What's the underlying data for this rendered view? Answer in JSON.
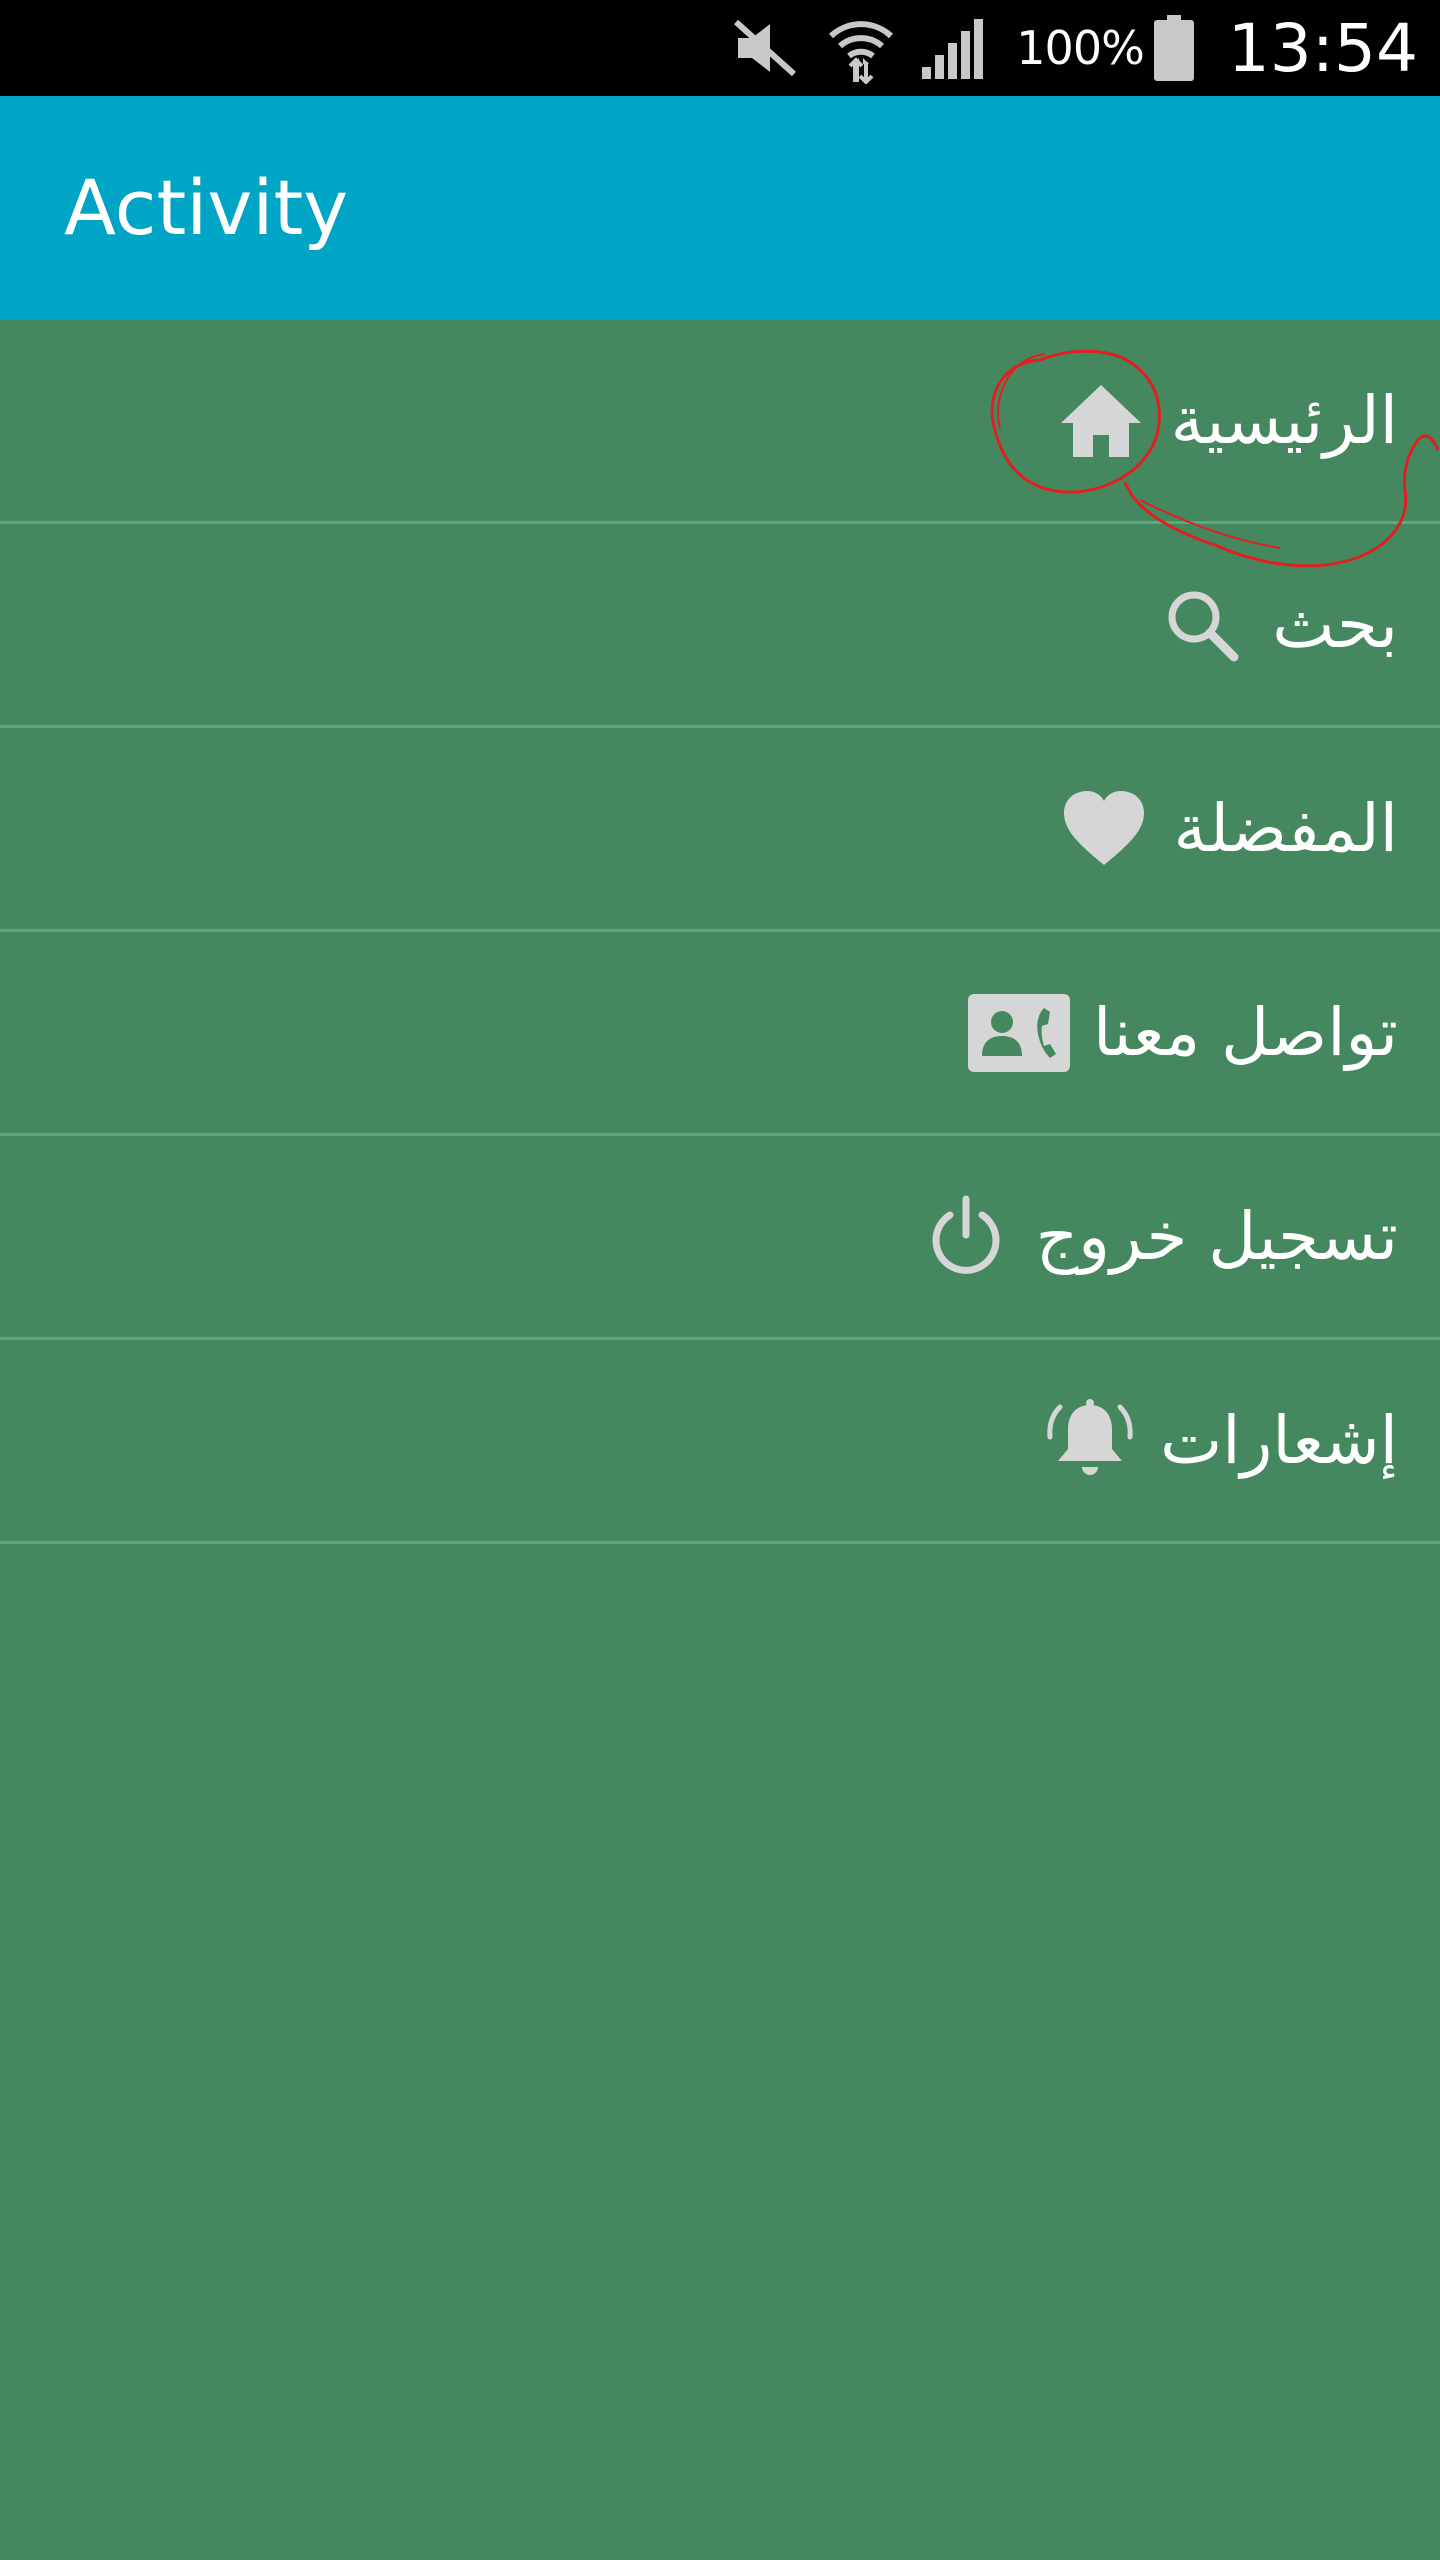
{
  "status_bar": {
    "battery_percent": "100%",
    "time": "13:54",
    "icons": [
      "mute-icon",
      "wifi-icon",
      "signal-icon",
      "battery-icon"
    ]
  },
  "app_bar": {
    "title": "Activity",
    "color": "#00a5c5"
  },
  "menu": {
    "background": "#45885f",
    "items": [
      {
        "label": "الرئيسية",
        "icon": "home-icon"
      },
      {
        "label": "بحث",
        "icon": "search-icon"
      },
      {
        "label": "المفضلة",
        "icon": "heart-icon"
      },
      {
        "label": "تواصل معنا",
        "icon": "contact-card-icon"
      },
      {
        "label": "تسجيل خروج",
        "icon": "power-icon"
      },
      {
        "label": "إشعارات",
        "icon": "bell-icon"
      }
    ]
  },
  "annotation": {
    "color": "#e02020",
    "target": "home-icon"
  }
}
